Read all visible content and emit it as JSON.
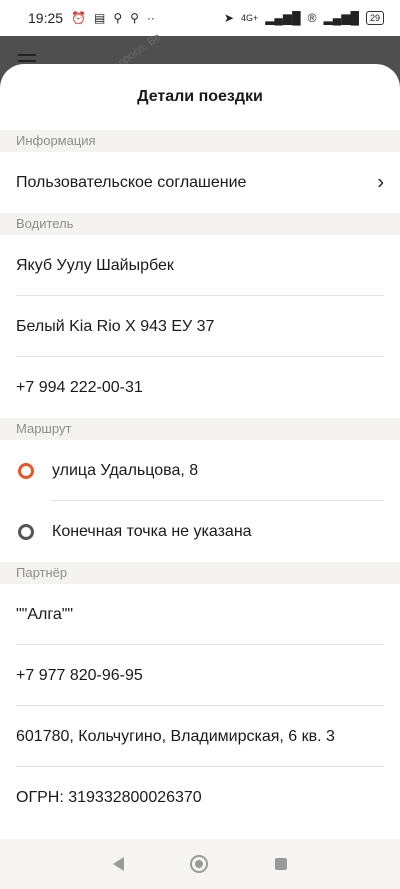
{
  "status_bar": {
    "time": "19:25",
    "network": "4G+",
    "battery": "29"
  },
  "map": {
    "street_label": "просп. Ве"
  },
  "sheet": {
    "title": "Детали поездки",
    "sections": {
      "info": {
        "header": "Информация",
        "agreement": "Пользовательское соглашение"
      },
      "driver": {
        "header": "Водитель",
        "name": "Якуб Уулу Шайырбек",
        "car": "Белый Kia Rio Х 943 ЕУ 37",
        "phone": "+7 994 222-00-31"
      },
      "route": {
        "header": "Маршрут",
        "start": "улица Удальцова, 8",
        "end": "Конечная точка не указана"
      },
      "partner": {
        "header": "Партнёр",
        "name": "\"\"Алга\"\"",
        "phone": "+7 977 820-96-95",
        "address": "601780, Кольчугино, Владимирская, 6 кв. 3",
        "ogrn": "ОГРН: 319332800026370"
      }
    }
  },
  "colors": {
    "accent_start_pin": "#e8562b",
    "section_bg": "#f4f3f1"
  }
}
